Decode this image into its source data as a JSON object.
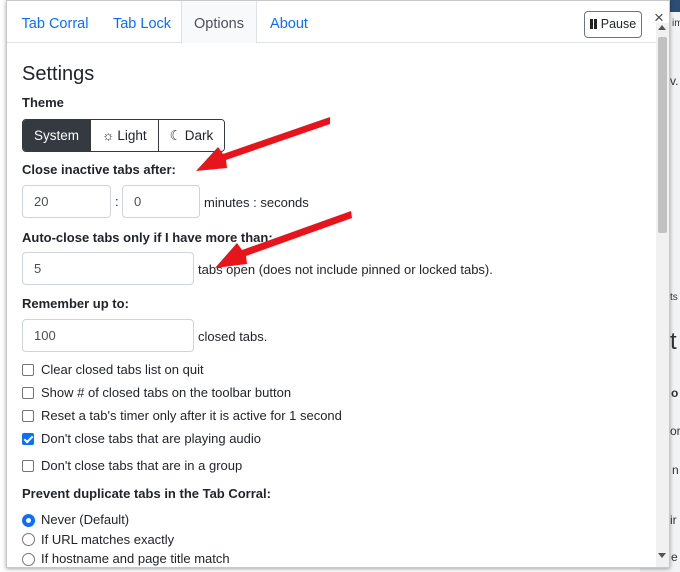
{
  "background": {
    "fragments": [
      "im",
      "v.",
      "ts",
      "t",
      "o",
      "or",
      "n",
      "ir",
      "e"
    ]
  },
  "tabs": [
    {
      "label": "Tab Corral"
    },
    {
      "label": "Tab Lock"
    },
    {
      "label": "Options",
      "active": true
    },
    {
      "label": "About"
    }
  ],
  "toolbar": {
    "pause_label": "Pause",
    "close_glyph": "×"
  },
  "settings": {
    "title": "Settings",
    "theme": {
      "label": "Theme",
      "options": [
        {
          "label": "System",
          "glyph": "",
          "selected": true
        },
        {
          "label": "Light",
          "glyph": "☼",
          "selected": false
        },
        {
          "label": "Dark",
          "glyph": "☾",
          "selected": false
        }
      ]
    },
    "close_inactive": {
      "label": "Close inactive tabs after:",
      "minutes": "20",
      "separator": ":",
      "seconds": "0",
      "suffix": "minutes : seconds"
    },
    "auto_close": {
      "label": "Auto-close tabs only if I have more than:",
      "value": "5",
      "suffix": "tabs open (does not include pinned or locked tabs)."
    },
    "remember": {
      "label": "Remember up to:",
      "value": "100",
      "suffix": "closed tabs."
    },
    "checkboxes": [
      {
        "label": "Clear closed tabs list on quit",
        "checked": false
      },
      {
        "label": "Show # of closed tabs on the toolbar button",
        "checked": false
      },
      {
        "label": "Reset a tab's timer only after it is active for 1 second",
        "checked": false
      },
      {
        "label": "Don't close tabs that are playing audio",
        "checked": true
      },
      {
        "label": "Don't close tabs that are in a group",
        "checked": false
      }
    ],
    "duplicates": {
      "label": "Prevent duplicate tabs in the Tab Corral:",
      "options": [
        {
          "label": "Never (Default)",
          "selected": true
        },
        {
          "label": "If URL matches exactly",
          "selected": false
        },
        {
          "label": "If hostname and page title match",
          "selected": false
        }
      ]
    }
  },
  "colors": {
    "accent": "#0d6efd",
    "annotation": "#e8141c",
    "dark_button": "#343a40"
  }
}
